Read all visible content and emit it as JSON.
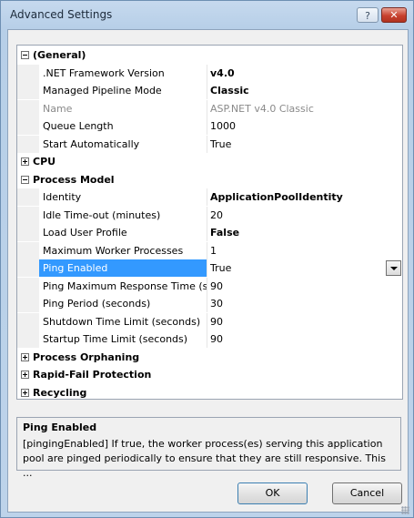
{
  "window": {
    "title": "Advanced Settings",
    "help_label": "?",
    "close_label": "✕"
  },
  "grid": {
    "rows": [
      {
        "type": "category",
        "label": "(General)",
        "expanded": true
      },
      {
        "type": "property",
        "name": ".NET Framework Version",
        "value": "v4.0",
        "value_bold": true
      },
      {
        "type": "property",
        "name": "Managed Pipeline Mode",
        "value": "Classic",
        "value_bold": true
      },
      {
        "type": "property",
        "name": "Name",
        "value": "ASP.NET v4.0 Classic",
        "disabled": true
      },
      {
        "type": "property",
        "name": "Queue Length",
        "value": "1000"
      },
      {
        "type": "property",
        "name": "Start Automatically",
        "value": "True"
      },
      {
        "type": "category",
        "label": "CPU",
        "expanded": false
      },
      {
        "type": "category",
        "label": "Process Model",
        "expanded": true
      },
      {
        "type": "property",
        "name": "Identity",
        "value": "ApplicationPoolIdentity",
        "value_bold": true
      },
      {
        "type": "property",
        "name": "Idle Time-out (minutes)",
        "value": "20"
      },
      {
        "type": "property",
        "name": "Load User Profile",
        "value": "False",
        "value_bold": true
      },
      {
        "type": "property",
        "name": "Maximum Worker Processes",
        "value": "1"
      },
      {
        "type": "property",
        "name": "Ping Enabled",
        "value": "True",
        "selected": true
      },
      {
        "type": "property",
        "name": "Ping Maximum Response Time (s",
        "value": "90"
      },
      {
        "type": "property",
        "name": "Ping Period (seconds)",
        "value": "30"
      },
      {
        "type": "property",
        "name": "Shutdown Time Limit (seconds)",
        "value": "90"
      },
      {
        "type": "property",
        "name": "Startup Time Limit (seconds)",
        "value": "90"
      },
      {
        "type": "category",
        "label": "Process Orphaning",
        "expanded": false
      },
      {
        "type": "category",
        "label": "Rapid-Fail Protection",
        "expanded": false
      },
      {
        "type": "category",
        "label": "Recycling",
        "expanded": false
      }
    ]
  },
  "description": {
    "title": "Ping Enabled",
    "text": "[pingingEnabled] If true, the worker process(es) serving this application pool are pinged periodically to ensure that they are still responsive.  This ..."
  },
  "buttons": {
    "ok": "OK",
    "cancel": "Cancel"
  }
}
